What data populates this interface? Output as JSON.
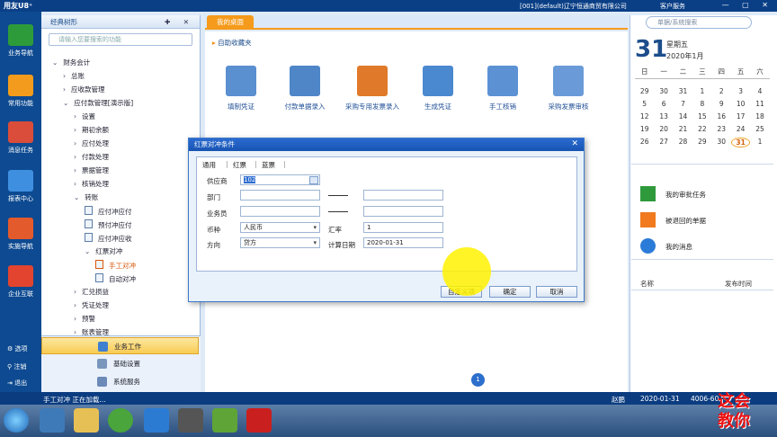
{
  "titlebar": {
    "logo": "用友U8⁺",
    "company": "[001](default)辽宁恒通商贸有限公司",
    "service": "客户服务",
    "controls": "— ▢ ✕"
  },
  "iconbar": {
    "items": [
      {
        "label": "业务导航",
        "icon": "business-nav-icon",
        "color": "#2e9b3a"
      },
      {
        "label": "常用功能",
        "icon": "star-icon",
        "color": "#f29b1c"
      },
      {
        "label": "消息任务",
        "icon": "calendar-icon",
        "color": "#d94d3a"
      },
      {
        "label": "报表中心",
        "icon": "report-icon",
        "color": "#3f8fe0"
      },
      {
        "label": "实施导航",
        "icon": "compass-icon",
        "color": "#e35a2c"
      },
      {
        "label": "企业互联",
        "icon": "link-icon",
        "color": "#e2442f"
      }
    ],
    "links": [
      "选项",
      "注销",
      "退出"
    ]
  },
  "tree": {
    "header": "经典树形",
    "pin": "✚ ✕",
    "search_placeholder": "请输入您要搜索的功能",
    "nodes": [
      "财务会计",
      "总账",
      "应收款管理",
      "应付款管理[演示版]",
      "设置",
      "期初余额",
      "应付处理",
      "付款处理",
      "票据管理",
      "核销处理",
      "转账",
      "应付冲应付",
      "预付冲应付",
      "应付冲应收",
      "红票对冲",
      "手工对冲",
      "自动对冲",
      "汇兑损益",
      "凭证处理",
      "预警",
      "账表管理"
    ]
  },
  "bottom_menu": [
    "业务工作",
    "基础设置",
    "系统服务"
  ],
  "tab": {
    "label": "我的桌面"
  },
  "favorites_header": "自助收藏夹",
  "shortcuts": [
    {
      "label": "填制凭证",
      "icon": "voucher-icon",
      "color": "#5a8fd0"
    },
    {
      "label": "付款单据录入",
      "icon": "payment-doc-icon",
      "color": "#4f86c8"
    },
    {
      "label": "采购专用发票录入",
      "icon": "invoice-icon",
      "color": "#e07a2a"
    },
    {
      "label": "生成凭证",
      "icon": "generate-voucher-icon",
      "color": "#4a88cf"
    },
    {
      "label": "手工核销",
      "icon": "manual-verify-icon",
      "color": "#5c92d4"
    },
    {
      "label": "采购发票审核",
      "icon": "invoice-audit-icon",
      "color": "#6a9bd8"
    }
  ],
  "pager": "1",
  "search": {
    "placeholder": "单据/系统搜索"
  },
  "calendar": {
    "day": "31",
    "weekday": "星期五",
    "year_month": "2020年1月",
    "week_head": [
      "日",
      "一",
      "二",
      "三",
      "四",
      "五",
      "六"
    ],
    "rows": [
      [
        "29",
        "30",
        "31",
        "1",
        "2",
        "3",
        "4"
      ],
      [
        "5",
        "6",
        "7",
        "8",
        "9",
        "10",
        "11"
      ],
      [
        "12",
        "13",
        "14",
        "15",
        "16",
        "17",
        "18"
      ],
      [
        "19",
        "20",
        "21",
        "22",
        "23",
        "24",
        "25"
      ],
      [
        "26",
        "27",
        "28",
        "29",
        "30",
        "31",
        "1"
      ]
    ]
  },
  "tasks": [
    {
      "label": "我的审批任务",
      "color": "#2f9a3b"
    },
    {
      "label": "被退回的单据",
      "color": "#f07a1d"
    },
    {
      "label": "我的消息",
      "color": "#2b7bd8"
    }
  ],
  "messages": {
    "name_header": "名称",
    "time_header": "发布时间"
  },
  "statusbar": {
    "left": "手工对冲 正在加载...",
    "user": "赵鹏",
    "date": "2020-01-31",
    "phone": "4006-60"
  },
  "dialog": {
    "title": "红票对冲条件",
    "tabs": [
      "通用",
      "红票",
      "蓝票"
    ],
    "fields": {
      "supplier_label": "供应商",
      "supplier_value": "102",
      "dept_label": "部门",
      "staff_label": "业务员",
      "currency_label": "币种",
      "currency_value": "人民币",
      "rate_label": "汇率",
      "rate_value": "1",
      "direction_label": "方向",
      "direction_value": "贷方",
      "calc_date_label": "计算日期",
      "calc_date_value": "2020-01-31"
    },
    "buttons": {
      "custom": "自定义项",
      "ok": "确定",
      "cancel": "取消"
    }
  },
  "watermark": "这会\n教你"
}
